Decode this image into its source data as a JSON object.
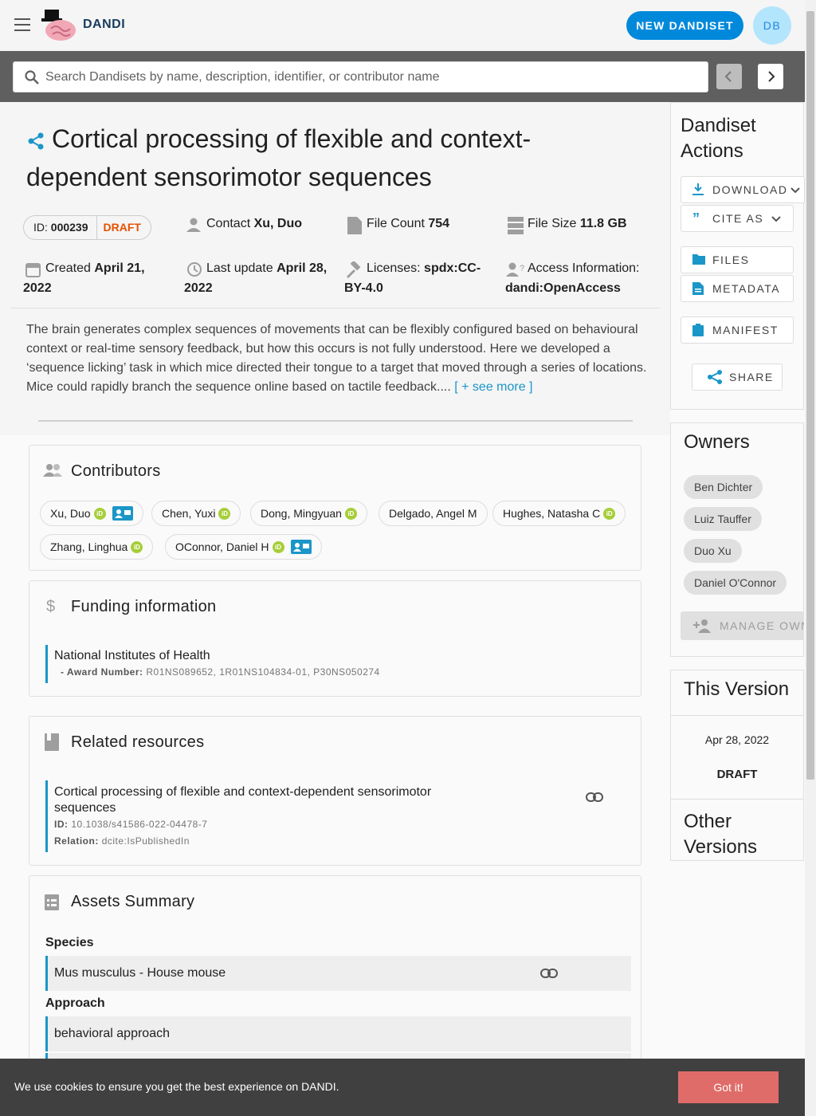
{
  "app": {
    "brand": "DANDI",
    "new_button": "NEW DANDISET",
    "avatar_initials": "DB"
  },
  "search": {
    "placeholder": "Search Dandisets by name, description, identifier, or contributor name"
  },
  "dandiset": {
    "title": "Cortical processing of flexible and context-dependent sensorimotor sequences",
    "id_label": "ID:",
    "id": "000239",
    "status": "DRAFT",
    "contact_label": "Contact",
    "contact": "Xu, Duo",
    "file_count_label": "File Count",
    "file_count": "754",
    "file_size_label": "File Size",
    "file_size": "11.8 GB",
    "created_label": "Created",
    "created": "April 21, 2022",
    "updated_label": "Last update",
    "updated": "April 28, 2022",
    "license_label": "Licenses:",
    "license": "spdx:CC-BY-4.0",
    "access_label": "Access Information:",
    "access": "dandi:OpenAccess",
    "description": "The brain generates complex sequences of movements that can be flexibly configured based on behavioural context or real-time sensory feedback, but how this occurs is not fully understood. Here we developed a ‘sequence licking’ task in which mice directed their tongue to a target that moved through a series of locations. Mice could rapidly branch the sequence online based on tactile feedback....",
    "see_more": "[ + see more ]"
  },
  "contributors": {
    "title": "Contributors",
    "people": [
      "Xu, Duo",
      "Chen, Yuxi",
      "Dong, Mingyuan",
      "Delgado, Angel M",
      "Hughes, Natasha C",
      "Zhang, Linghua",
      "OConnor, Daniel H"
    ]
  },
  "funding": {
    "title": "Funding information",
    "org": "National Institutes of Health",
    "award_label": "- Award Number:",
    "award": "R01NS089652, 1R01NS104834-01, P30NS050274"
  },
  "related": {
    "title": "Related resources",
    "name": "Cortical processing of flexible and context-dependent sensorimotor sequences",
    "id_label": "ID:",
    "id": "10.1038/s41586-022-04478-7",
    "relation_label": "Relation:",
    "relation": "dcite:IsPublishedIn"
  },
  "assets": {
    "title": "Assets Summary",
    "species_label": "Species",
    "species": "Mus musculus - House mouse",
    "approach_label": "Approach",
    "approach": "behavioral approach"
  },
  "actions": {
    "title": "Dandiset Actions",
    "download": "DOWNLOAD",
    "cite": "CITE AS",
    "files": "FILES",
    "metadata": "METADATA",
    "manifest": "MANIFEST",
    "share": "SHARE"
  },
  "owners": {
    "title": "Owners",
    "list": [
      "Ben Dichter",
      "Luiz Tauffer",
      "Duo Xu",
      "Daniel O'Connor"
    ],
    "manage": "MANAGE OWN"
  },
  "version": {
    "title": "This Version",
    "date": "Apr 28, 2022",
    "name": "DRAFT",
    "other_title": "Other Versions"
  },
  "cookie": {
    "text": "We use cookies to ensure you get the best experience on DANDI.",
    "button": "Got it!"
  },
  "colors": {
    "accent": "#1a96c8",
    "primary_button": "#0089db",
    "draft": "#e65100",
    "orcid": "#a6ce39",
    "cookie_button": "#e06c69"
  }
}
